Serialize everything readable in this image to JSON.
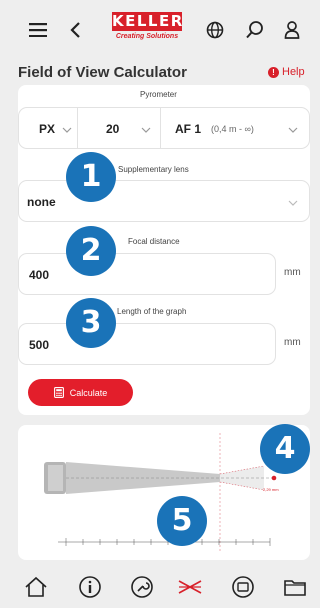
{
  "header": {
    "menu_icon": "menu-icon",
    "back_icon": "back-chevron-icon",
    "logo_text": "KELLER",
    "logo_tagline": "Creating Solutions",
    "globe_icon": "globe-icon",
    "search_icon": "search-icon",
    "user_icon": "user-icon"
  },
  "page": {
    "title": "Field of View Calculator",
    "help_label": "Help",
    "accent": "#d8202a"
  },
  "form": {
    "pyrometer": {
      "label": "Pyrometer",
      "series": "PX",
      "model": "20",
      "optics_name": "AF 1",
      "optics_range": "(0,4 m - ∞)"
    },
    "supplementary_lens": {
      "label": "Supplementary lens",
      "value": "none"
    },
    "focal_distance": {
      "label": "Focal distance",
      "value": "400",
      "unit": "mm"
    },
    "graph_length": {
      "label": "Length of the graph",
      "value": "500",
      "unit": "mm"
    },
    "calculate_label": "Calculate"
  },
  "graph": {
    "spot_label": "2,29 mm"
  },
  "badges": [
    "1",
    "2",
    "3",
    "4",
    "5"
  ],
  "badge_color": "#1a73b8",
  "navbar": {
    "items": [
      "home-icon",
      "info-icon",
      "wrench-icon",
      "field-of-view-icon",
      "device-icon",
      "folder-icon"
    ],
    "active_color": "#d8202a"
  }
}
